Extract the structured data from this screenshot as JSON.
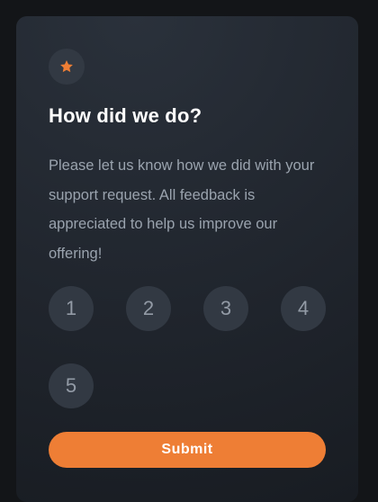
{
  "card": {
    "icon": "star-icon",
    "title": "How did we do?",
    "description": "Please let us know how we did with your support request. All feedback is appreciated to help us improve our offering!",
    "ratings": [
      "1",
      "2",
      "3",
      "4",
      "5"
    ],
    "submit_label": "Submit"
  },
  "colors": {
    "accent": "#ee7e35",
    "card_background": "#20252d",
    "page_background": "#131518",
    "rating_circle": "#323943",
    "muted_text": "#9aa3ae"
  }
}
